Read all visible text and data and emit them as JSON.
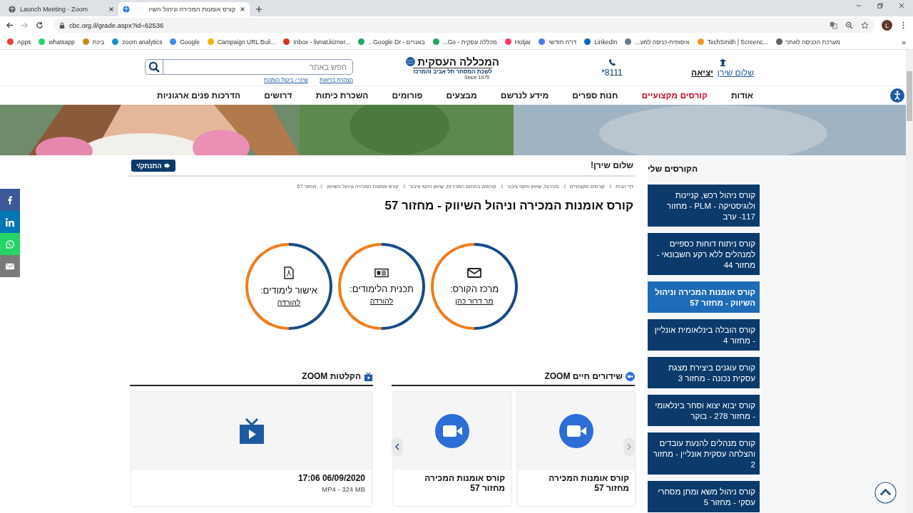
{
  "browser": {
    "tabs": [
      {
        "title": "קורס אומנות המכירה וניהול השיו",
        "selected": true
      },
      {
        "title": "Launch Meeting - Zoom",
        "selected": false
      }
    ],
    "url": "cbc.org.il/grade.aspx?id=62536",
    "avatar": "L",
    "bookmarks": [
      {
        "label": "מערכת הכניסה לאתר",
        "color": "#5f6368"
      },
      {
        "label": "TechSmith | Screenc...",
        "color": "#f7941d"
      },
      {
        "label": "איסופית-כניסה למע...",
        "color": "#6b7b8c"
      },
      {
        "label": "LinkedIn",
        "color": "#0a66c2"
      },
      {
        "label": "דו\"ח חודשי",
        "color": "#4a7bec"
      },
      {
        "label": "Hotjar",
        "color": "#fd3a5c"
      },
      {
        "label": "מכללה עסקית - Go...",
        "color": "#1fa463"
      },
      {
        "label": "באנרים - Google Dr...",
        "color": "#1fa463"
      },
      {
        "label": "Inbox - livnat.kizner...",
        "color": "#d93025"
      },
      {
        "label": "Campaign URL Buil...",
        "color": "#f4b400"
      },
      {
        "label": "Google",
        "color": "#4285f4"
      },
      {
        "label": "zoom analytics",
        "color": "#1a8fc7"
      },
      {
        "label": "בינת",
        "color": "#c98a1b"
      },
      {
        "label": "whatsapp",
        "color": "#25d366"
      },
      {
        "label": "Apps",
        "color": "#e94235"
      }
    ],
    "more": "»"
  },
  "header": {
    "greeting": "שלום שירן",
    "logout": "יציאה",
    "phone": "*8111",
    "logo_title": "המכללה העסקית",
    "logo_subtitle": "לשכת המסחר תל אביב והמרכז",
    "logo_since": "Since 1975",
    "search": {
      "placeholder": "חפש באתר"
    },
    "links": [
      "הצהרת בריאות",
      "שינוי / ביטול הזמנות"
    ]
  },
  "nav": [
    {
      "label": "אודות",
      "selected": false
    },
    {
      "label": "קורסים מקצועיים",
      "selected": true
    },
    {
      "label": "חנות ספרים",
      "selected": false
    },
    {
      "label": "מידע לנרשם",
      "selected": false
    },
    {
      "label": "מבצעים",
      "selected": false
    },
    {
      "label": "פורומים",
      "selected": false
    },
    {
      "label": "השכרת כיתות",
      "selected": false
    },
    {
      "label": "דרושים",
      "selected": false
    },
    {
      "label": "הדרכות פנים ארגוניות",
      "selected": false
    }
  ],
  "main": {
    "greeting": "שלום שירן!",
    "logout_button": "התנתק/י",
    "breadcrumbs": [
      "דף הבית",
      "קורסים מקצועיים",
      "מכירות, שיווק ויחסי ציבור",
      "קורסים בתחום המכירות, שיווק ויחסי ציבור",
      "קורס אומנות המכירה וניהול השיווק",
      "מחזור 57"
    ],
    "title": "קורס אומנות המכירה וניהול השיווק - מחזור 57",
    "info_circles": [
      {
        "kind": "mail",
        "label": "מרכז הקורס:",
        "link": "מר דרור כהן"
      },
      {
        "kind": "document",
        "label": "תכנית הלימודים:",
        "link": "להורדה"
      },
      {
        "kind": "pdf",
        "label": "אישור לימודים:",
        "link": "להורדה"
      }
    ],
    "live": {
      "heading": "שידורים חיים ZOOM",
      "cards": [
        {
          "title": "קורס אומנות המכירה מחזור 57"
        },
        {
          "title": "קורס אומנות המכירה מחזור 57"
        }
      ]
    },
    "recordings": {
      "heading": "הקלטות ZOOM",
      "cards": [
        {
          "date": "17:06 06/09/2020",
          "meta": "MP4 - 324 MB"
        }
      ]
    }
  },
  "sidebar": {
    "title": "הקורסים שלי",
    "courses": [
      {
        "label": "קורס ניהול רכש, קניינות ולוגיסטיקה - PLM - מחזור 117- ערב",
        "selected": false
      },
      {
        "label": "קורס ניתוח דוחות כספיים למנהלים ללא רקע חשבונאי - מחזור 44",
        "selected": false
      },
      {
        "label": "קורס אומנות המכירה וניהול השיווק - מחזור 57",
        "selected": true
      },
      {
        "label": "קורס הובלה בינלאומית אונליין - מחזור 4",
        "selected": false
      },
      {
        "label": "קורס עוגנים ביצירת מצגת עסקית נכונה - מחזור 3",
        "selected": false
      },
      {
        "label": "קורס יבוא יצוא וסחר בינלאומי - מחזור 278 - בוקר",
        "selected": false
      },
      {
        "label": "קורס מנהלים להנעת עובדים והצלחה עסקית אונליין - מחזור 2",
        "selected": false
      },
      {
        "label": "קורס ניהול משא ומתן מסחרי עסקי - מחזור 5",
        "selected": false
      }
    ]
  }
}
